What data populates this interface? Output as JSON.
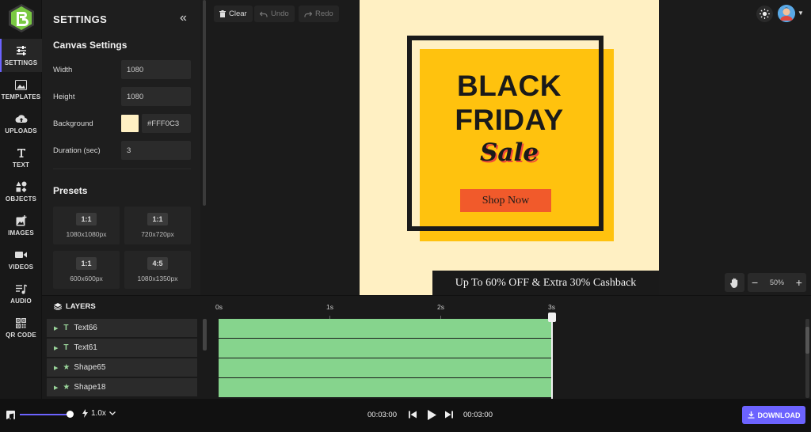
{
  "rail": {
    "items": [
      {
        "label": "SETTINGS",
        "icon": "sliders-icon"
      },
      {
        "label": "TEMPLATES",
        "icon": "image-icon"
      },
      {
        "label": "UPLOADS",
        "icon": "upload-cloud-icon"
      },
      {
        "label": "TEXT",
        "icon": "text-icon"
      },
      {
        "label": "OBJECTS",
        "icon": "shapes-icon"
      },
      {
        "label": "IMAGES",
        "icon": "add-image-icon"
      },
      {
        "label": "VIDEOS",
        "icon": "video-camera-icon"
      },
      {
        "label": "AUDIO",
        "icon": "music-list-icon"
      },
      {
        "label": "QR CODE",
        "icon": "qr-code-icon"
      }
    ]
  },
  "panel": {
    "title": "SETTINGS",
    "canvas_settings_title": "Canvas Settings",
    "width_label": "Width",
    "width_value": "1080",
    "height_label": "Height",
    "height_value": "1080",
    "background_label": "Background",
    "background_value": "#FFF0C3",
    "background_color": "#fff0c3",
    "duration_label": "Duration (sec)",
    "duration_value": "3",
    "presets_title": "Presets",
    "presets": [
      {
        "ratio": "1:1",
        "size": "1080x1080px"
      },
      {
        "ratio": "1:1",
        "size": "720x720px"
      },
      {
        "ratio": "1:1",
        "size": "600x600px"
      },
      {
        "ratio": "4:5",
        "size": "1080x1350px"
      }
    ]
  },
  "toolbar": {
    "clear_label": "Clear",
    "undo_label": "Undo",
    "redo_label": "Redo"
  },
  "canvas": {
    "line1": "BLACK",
    "line2": "FRIDAY",
    "sale": "Sale",
    "shop_button": "Shop Now",
    "banner": "Up To 60% OFF & Extra 30% Cashback"
  },
  "zoom": {
    "level": "50%",
    "minus": "−",
    "plus": "+"
  },
  "layers": {
    "title": "LAYERS",
    "items": [
      {
        "type": "T",
        "name": "Text66"
      },
      {
        "type": "T",
        "name": "Text61"
      },
      {
        "type": "★",
        "name": "Shape65"
      },
      {
        "type": "★",
        "name": "Shape18"
      }
    ]
  },
  "ruler": {
    "ticks": [
      "0s",
      "1s",
      "2s",
      "3s"
    ]
  },
  "player": {
    "speed": "1.0x",
    "current_time": "00:03:00",
    "total_time": "00:03:00",
    "download_label": "DOWNLOAD"
  },
  "colors": {
    "accent": "#6c63ff",
    "track": "#86d48d",
    "ad_yellow": "#ffc20e",
    "ad_orange": "#f15a2b"
  }
}
